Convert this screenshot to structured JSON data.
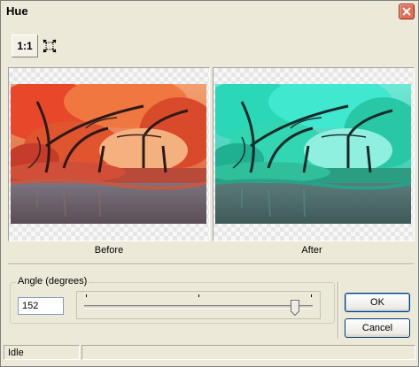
{
  "window": {
    "title": "Hue"
  },
  "toolbar": {
    "actual_size_label": "1:1",
    "fit_icon": "fit-to-window-icon"
  },
  "preview": {
    "before_label": "Before",
    "after_label": "After"
  },
  "angle": {
    "group_label": "Angle (degrees)",
    "value": "152",
    "slider_min": -180,
    "slider_max": 180,
    "slider_value": 152
  },
  "buttons": {
    "ok": "OK",
    "cancel": "Cancel"
  },
  "status": {
    "text": "Idle",
    "second": ""
  },
  "colors": {
    "accent": "#003c74",
    "close": "#e46e53"
  }
}
